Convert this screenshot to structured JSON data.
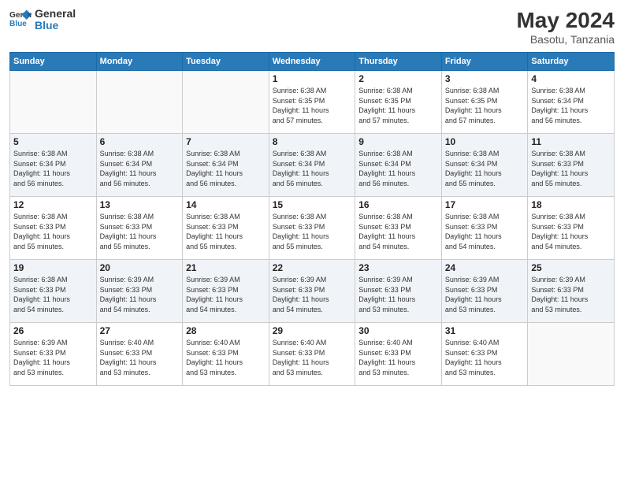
{
  "header": {
    "logo_general": "General",
    "logo_blue": "Blue",
    "month_year": "May 2024",
    "location": "Basotu, Tanzania"
  },
  "days_of_week": [
    "Sunday",
    "Monday",
    "Tuesday",
    "Wednesday",
    "Thursday",
    "Friday",
    "Saturday"
  ],
  "weeks": [
    [
      {
        "day": "",
        "info": ""
      },
      {
        "day": "",
        "info": ""
      },
      {
        "day": "",
        "info": ""
      },
      {
        "day": "1",
        "info": "Sunrise: 6:38 AM\nSunset: 6:35 PM\nDaylight: 11 hours\nand 57 minutes."
      },
      {
        "day": "2",
        "info": "Sunrise: 6:38 AM\nSunset: 6:35 PM\nDaylight: 11 hours\nand 57 minutes."
      },
      {
        "day": "3",
        "info": "Sunrise: 6:38 AM\nSunset: 6:35 PM\nDaylight: 11 hours\nand 57 minutes."
      },
      {
        "day": "4",
        "info": "Sunrise: 6:38 AM\nSunset: 6:34 PM\nDaylight: 11 hours\nand 56 minutes."
      }
    ],
    [
      {
        "day": "5",
        "info": "Sunrise: 6:38 AM\nSunset: 6:34 PM\nDaylight: 11 hours\nand 56 minutes."
      },
      {
        "day": "6",
        "info": "Sunrise: 6:38 AM\nSunset: 6:34 PM\nDaylight: 11 hours\nand 56 minutes."
      },
      {
        "day": "7",
        "info": "Sunrise: 6:38 AM\nSunset: 6:34 PM\nDaylight: 11 hours\nand 56 minutes."
      },
      {
        "day": "8",
        "info": "Sunrise: 6:38 AM\nSunset: 6:34 PM\nDaylight: 11 hours\nand 56 minutes."
      },
      {
        "day": "9",
        "info": "Sunrise: 6:38 AM\nSunset: 6:34 PM\nDaylight: 11 hours\nand 56 minutes."
      },
      {
        "day": "10",
        "info": "Sunrise: 6:38 AM\nSunset: 6:34 PM\nDaylight: 11 hours\nand 55 minutes."
      },
      {
        "day": "11",
        "info": "Sunrise: 6:38 AM\nSunset: 6:33 PM\nDaylight: 11 hours\nand 55 minutes."
      }
    ],
    [
      {
        "day": "12",
        "info": "Sunrise: 6:38 AM\nSunset: 6:33 PM\nDaylight: 11 hours\nand 55 minutes."
      },
      {
        "day": "13",
        "info": "Sunrise: 6:38 AM\nSunset: 6:33 PM\nDaylight: 11 hours\nand 55 minutes."
      },
      {
        "day": "14",
        "info": "Sunrise: 6:38 AM\nSunset: 6:33 PM\nDaylight: 11 hours\nand 55 minutes."
      },
      {
        "day": "15",
        "info": "Sunrise: 6:38 AM\nSunset: 6:33 PM\nDaylight: 11 hours\nand 55 minutes."
      },
      {
        "day": "16",
        "info": "Sunrise: 6:38 AM\nSunset: 6:33 PM\nDaylight: 11 hours\nand 54 minutes."
      },
      {
        "day": "17",
        "info": "Sunrise: 6:38 AM\nSunset: 6:33 PM\nDaylight: 11 hours\nand 54 minutes."
      },
      {
        "day": "18",
        "info": "Sunrise: 6:38 AM\nSunset: 6:33 PM\nDaylight: 11 hours\nand 54 minutes."
      }
    ],
    [
      {
        "day": "19",
        "info": "Sunrise: 6:38 AM\nSunset: 6:33 PM\nDaylight: 11 hours\nand 54 minutes."
      },
      {
        "day": "20",
        "info": "Sunrise: 6:39 AM\nSunset: 6:33 PM\nDaylight: 11 hours\nand 54 minutes."
      },
      {
        "day": "21",
        "info": "Sunrise: 6:39 AM\nSunset: 6:33 PM\nDaylight: 11 hours\nand 54 minutes."
      },
      {
        "day": "22",
        "info": "Sunrise: 6:39 AM\nSunset: 6:33 PM\nDaylight: 11 hours\nand 54 minutes."
      },
      {
        "day": "23",
        "info": "Sunrise: 6:39 AM\nSunset: 6:33 PM\nDaylight: 11 hours\nand 53 minutes."
      },
      {
        "day": "24",
        "info": "Sunrise: 6:39 AM\nSunset: 6:33 PM\nDaylight: 11 hours\nand 53 minutes."
      },
      {
        "day": "25",
        "info": "Sunrise: 6:39 AM\nSunset: 6:33 PM\nDaylight: 11 hours\nand 53 minutes."
      }
    ],
    [
      {
        "day": "26",
        "info": "Sunrise: 6:39 AM\nSunset: 6:33 PM\nDaylight: 11 hours\nand 53 minutes."
      },
      {
        "day": "27",
        "info": "Sunrise: 6:40 AM\nSunset: 6:33 PM\nDaylight: 11 hours\nand 53 minutes."
      },
      {
        "day": "28",
        "info": "Sunrise: 6:40 AM\nSunset: 6:33 PM\nDaylight: 11 hours\nand 53 minutes."
      },
      {
        "day": "29",
        "info": "Sunrise: 6:40 AM\nSunset: 6:33 PM\nDaylight: 11 hours\nand 53 minutes."
      },
      {
        "day": "30",
        "info": "Sunrise: 6:40 AM\nSunset: 6:33 PM\nDaylight: 11 hours\nand 53 minutes."
      },
      {
        "day": "31",
        "info": "Sunrise: 6:40 AM\nSunset: 6:33 PM\nDaylight: 11 hours\nand 53 minutes."
      },
      {
        "day": "",
        "info": ""
      }
    ]
  ]
}
